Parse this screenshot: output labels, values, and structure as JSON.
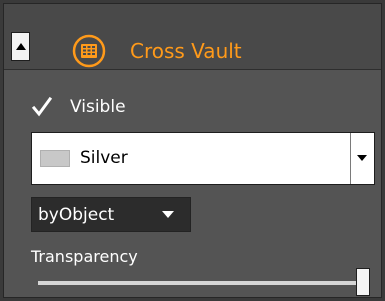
{
  "header": {
    "title": "Cross Vault",
    "icon": "cross-vault-grid-icon",
    "collapse_icon": "triangle-up-icon",
    "accent_color": "#ff9a1a"
  },
  "visibility": {
    "label": "Visible",
    "checked": true
  },
  "material": {
    "value": "Silver",
    "swatch_color": "#c8c8c8"
  },
  "mode": {
    "value": "byObject"
  },
  "transparency": {
    "label": "Transparency",
    "value_fraction": 1.0
  }
}
